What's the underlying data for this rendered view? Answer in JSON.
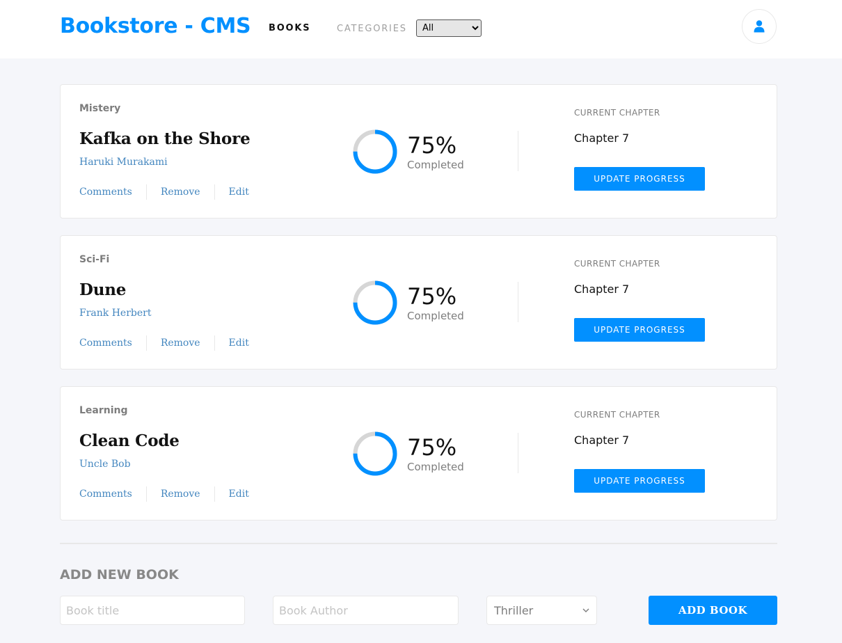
{
  "header": {
    "brand": "Bookstore - CMS",
    "nav_books": "BOOKS",
    "nav_categories": "CATEGORIES",
    "categories_selected": "All",
    "avatar_icon": "user-icon"
  },
  "colors": {
    "accent": "#0290ff",
    "link": "#4386bf",
    "ring_track": "#e8e8e8"
  },
  "books": [
    {
      "genre": "Mistery",
      "title": "Kafka on the Shore",
      "author": "Haruki Murakami",
      "actions": [
        "Comments",
        "Remove",
        "Edit"
      ],
      "progress_percent": 75,
      "progress_text": "75%",
      "completed_label": "Completed",
      "current_chapter_label": "CURRENT CHAPTER",
      "chapter": "Chapter 7",
      "update_label": "UPDATE PROGRESS"
    },
    {
      "genre": "Sci-Fi",
      "title": "Dune",
      "author": "Frank Herbert",
      "actions": [
        "Comments",
        "Remove",
        "Edit"
      ],
      "progress_percent": 75,
      "progress_text": "75%",
      "completed_label": "Completed",
      "current_chapter_label": "CURRENT CHAPTER",
      "chapter": "Chapter 7",
      "update_label": "UPDATE PROGRESS"
    },
    {
      "genre": "Learning",
      "title": "Clean Code",
      "author": "Uncle Bob",
      "actions": [
        "Comments",
        "Remove",
        "Edit"
      ],
      "progress_percent": 75,
      "progress_text": "75%",
      "completed_label": "Completed",
      "current_chapter_label": "CURRENT CHAPTER",
      "chapter": "Chapter 7",
      "update_label": "UPDATE PROGRESS"
    }
  ],
  "add_book": {
    "heading": "ADD NEW BOOK",
    "title_placeholder": "Book title",
    "author_placeholder": "Book Author",
    "genre_selected": "Thriller",
    "submit_label": "ADD BOOK"
  }
}
